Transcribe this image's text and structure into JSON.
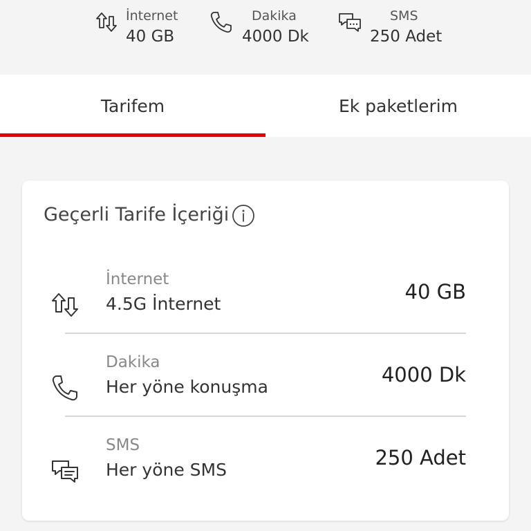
{
  "summary": {
    "internet": {
      "label": "İnternet",
      "value": "40 GB",
      "icon": "data-arrows-icon"
    },
    "dakika": {
      "label": "Dakika",
      "value": "4000 Dk",
      "icon": "phone-icon"
    },
    "sms": {
      "label": "SMS",
      "value": "250 Adet",
      "icon": "chat-bubbles-icon"
    }
  },
  "tabs": [
    {
      "label": "Tarifem",
      "active": true
    },
    {
      "label": "Ek paketlerim",
      "active": false
    }
  ],
  "card": {
    "title": "Geçerli Tarife İçeriği",
    "rows": [
      {
        "label": "İnternet",
        "description": "4.5G İnternet",
        "value": "40 GB",
        "icon": "data-arrows-icon"
      },
      {
        "label": "Dakika",
        "description": "Her yöne konuşma",
        "value": "4000 Dk",
        "icon": "phone-icon"
      },
      {
        "label": "SMS",
        "description": "Her yöne SMS",
        "value": "250 Adet",
        "icon": "chat-bubbles-icon"
      }
    ]
  },
  "colors": {
    "accent": "#e60000",
    "background": "#f4f4f4",
    "card": "#ffffff"
  }
}
